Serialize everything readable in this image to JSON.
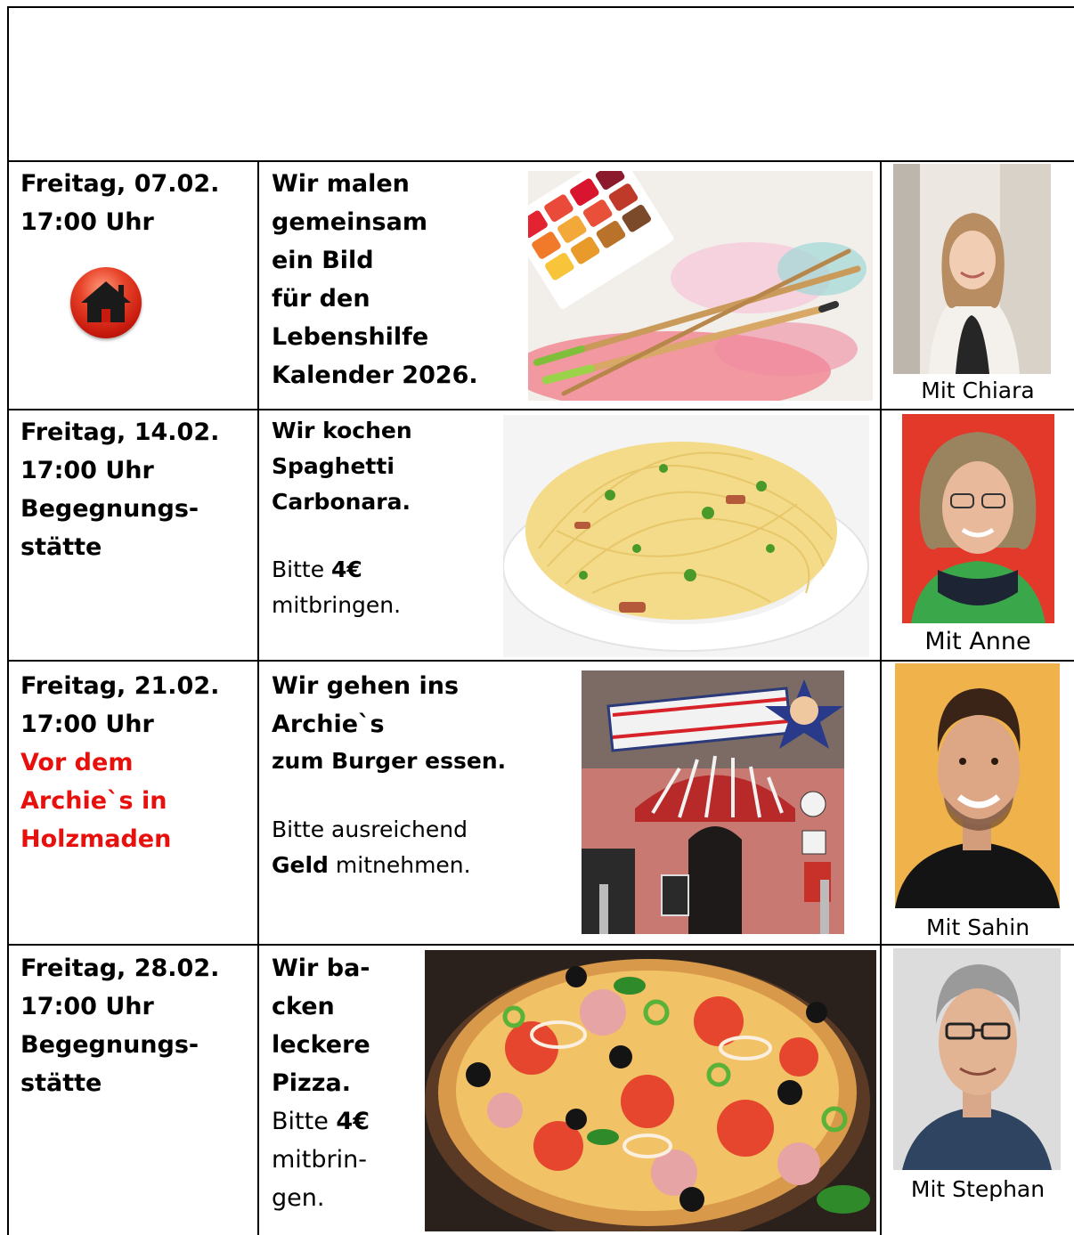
{
  "rows": [
    {
      "date_line1": "Freitag, 07.02.",
      "date_line2": "17:00 Uhr",
      "location_icon": "home-icon",
      "activity_lines": [
        "Wir malen",
        "gemeinsam",
        "ein Bild",
        "für den",
        "Lebenshilfe",
        "Kalender 2026."
      ],
      "image": "watercolor-paints-and-brushes",
      "person_caption": "Mit Chiara"
    },
    {
      "date_line1": "Freitag, 14.02.",
      "date_line2": "17:00 Uhr",
      "location_line1": "Begegnungs-",
      "location_line2": "stätte",
      "activity_lines": [
        "Wir kochen",
        "Spaghetti",
        "Carbonara."
      ],
      "note_prefix": "Bitte ",
      "note_bold": "4€",
      "note_suffix": "mitbringen.",
      "image": "spaghetti-carbonara-plate",
      "person_caption": "Mit Anne"
    },
    {
      "date_line1": "Freitag, 21.02.",
      "date_line2": "17:00 Uhr",
      "location_lines": [
        "Vor dem",
        "Archie`s in",
        "Holzmaden"
      ],
      "activity_lines": [
        "Wir gehen ins",
        "Archie`s",
        "zum Burger essen."
      ],
      "note_line1": "Bitte ausreichend",
      "note_bold": "Geld",
      "note_suffix": " mitnehmen.",
      "image": "archies-restaurant-entrance",
      "person_caption": "Mit Sahin"
    },
    {
      "date_line1": "Freitag, 28.02.",
      "date_line2": "17:00 Uhr",
      "location_line1": "Begegnungs-",
      "location_line2": "stätte",
      "activity_lines": [
        "Wir ba-",
        "cken",
        "leckere",
        "Pizza."
      ],
      "note_prefix": "Bitte ",
      "note_bold": "4€",
      "note_lines": [
        "mitbrin-",
        "gen."
      ],
      "image": "pizza-salami-olives",
      "person_caption": "Mit Stephan"
    }
  ],
  "colors": {
    "location_highlight": "#e8100c"
  }
}
